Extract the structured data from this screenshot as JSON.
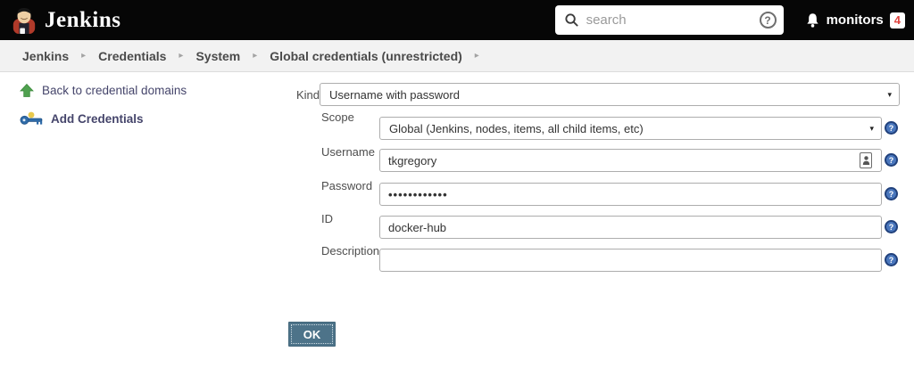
{
  "header": {
    "app_title": "Jenkins",
    "search": {
      "placeholder": "search"
    },
    "monitors": {
      "label": "monitors",
      "count": "4"
    }
  },
  "breadcrumb": {
    "items": [
      "Jenkins",
      "Credentials",
      "System",
      "Global credentials (unrestricted)"
    ]
  },
  "sidebar": {
    "items": [
      {
        "label": "Back to credential domains",
        "icon": "up-arrow-icon"
      },
      {
        "label": "Add Credentials",
        "icon": "key-icon"
      }
    ]
  },
  "form": {
    "fields": [
      {
        "label": "Kind",
        "type": "select",
        "value": "Username with password"
      },
      {
        "label": "Scope",
        "type": "select",
        "value": "Global (Jenkins, nodes, items, all child items, etc)"
      },
      {
        "label": "Username",
        "type": "text",
        "value": "tkgregory"
      },
      {
        "label": "Password",
        "type": "password",
        "value": "••••••••••••"
      },
      {
        "label": "ID",
        "type": "text",
        "value": "docker-hub"
      },
      {
        "label": "Description",
        "type": "text",
        "value": ""
      }
    ],
    "ok_label": "OK"
  },
  "icons": {
    "chevron": "▸",
    "select_arrow": "▾",
    "question": "?"
  },
  "colors": {
    "header_bg": "#060606",
    "breadcrumb_bg": "#f2f2f2",
    "ok_button": "#4d7389",
    "help_icon": "#4a77bd",
    "badge_text": "#e0443f",
    "sidebar_link": "#45456b",
    "back_arrow_green": "#4fa14f",
    "key_blue": "#2f6ba8",
    "key_gold": "#e9c94c"
  }
}
